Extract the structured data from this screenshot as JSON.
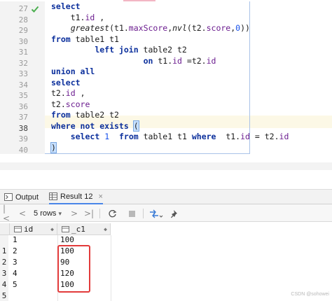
{
  "editor": {
    "line_numbers": [
      "27",
      "28",
      "29",
      "30",
      "31",
      "32",
      "33",
      "34",
      "35",
      "36",
      "37",
      "38",
      "39",
      "40"
    ],
    "active_line": "38",
    "lines": [
      [
        {
          "t": "select",
          "c": "kw"
        }
      ],
      [
        {
          "t": "    t1.",
          "c": ""
        },
        {
          "t": "id",
          "c": "fld"
        },
        {
          "t": " ,",
          "c": ""
        }
      ],
      [
        {
          "t": "    ",
          "c": ""
        },
        {
          "t": "greatest",
          "c": "fn"
        },
        {
          "t": "(t1.",
          "c": ""
        },
        {
          "t": "maxScore",
          "c": "fld"
        },
        {
          "t": ",",
          "c": ""
        },
        {
          "t": "nvl",
          "c": "fn"
        },
        {
          "t": "(t2.",
          "c": ""
        },
        {
          "t": "score",
          "c": "fld"
        },
        {
          "t": ",",
          "c": ""
        },
        {
          "t": "0",
          "c": "num"
        },
        {
          "t": "))",
          "c": ""
        }
      ],
      [
        {
          "t": "from",
          "c": "kw"
        },
        {
          "t": " table1 t1",
          "c": ""
        }
      ],
      [
        {
          "t": "         ",
          "c": ""
        },
        {
          "t": "left join",
          "c": "kw"
        },
        {
          "t": " table2 t2",
          "c": ""
        }
      ],
      [
        {
          "t": "                   ",
          "c": ""
        },
        {
          "t": "on",
          "c": "kw"
        },
        {
          "t": " t1.",
          "c": ""
        },
        {
          "t": "id",
          "c": "fld"
        },
        {
          "t": " =t2.",
          "c": ""
        },
        {
          "t": "id",
          "c": "fld"
        }
      ],
      [
        {
          "t": "union all",
          "c": "kw"
        }
      ],
      [
        {
          "t": "select",
          "c": "kw"
        }
      ],
      [
        {
          "t": "t2.",
          "c": ""
        },
        {
          "t": "id",
          "c": "fld"
        },
        {
          "t": " ,",
          "c": ""
        }
      ],
      [
        {
          "t": "t2.",
          "c": ""
        },
        {
          "t": "score",
          "c": "fld"
        }
      ],
      [
        {
          "t": "from",
          "c": "kw"
        },
        {
          "t": " table2 t2",
          "c": ""
        }
      ],
      [
        {
          "t": "where not exists",
          "c": "kw"
        },
        {
          "t": " ",
          "c": ""
        },
        {
          "t": "(",
          "c": "brace-hl"
        }
      ],
      [
        {
          "t": "    ",
          "c": ""
        },
        {
          "t": "select",
          "c": "kw"
        },
        {
          "t": " ",
          "c": ""
        },
        {
          "t": "1",
          "c": "num"
        },
        {
          "t": "  ",
          "c": ""
        },
        {
          "t": "from",
          "c": "kw"
        },
        {
          "t": " table1 t1 ",
          "c": ""
        },
        {
          "t": "where",
          "c": "kw"
        },
        {
          "t": "  t1.",
          "c": ""
        },
        {
          "t": "id",
          "c": "fld"
        },
        {
          "t": " = t2.",
          "c": ""
        },
        {
          "t": "id",
          "c": "fld"
        }
      ],
      [
        {
          "t": ")",
          "c": "brace-hl"
        }
      ]
    ]
  },
  "tabs": {
    "output_label": "Output",
    "result_label": "Result 12",
    "close_glyph": "×"
  },
  "toolbar": {
    "first_glyph": "|<",
    "prev_glyph": "<",
    "rows_label": "5 rows",
    "rows_caret": "▾",
    "next_glyph": ">",
    "last_glyph": ">|"
  },
  "grid": {
    "columns": [
      "id",
      "_c1"
    ],
    "rows": [
      {
        "num": "",
        "id": "1",
        "c1": "100"
      },
      {
        "num": "1",
        "id": "2",
        "c1": "100"
      },
      {
        "num": "2",
        "id": "3",
        "c1": "90"
      },
      {
        "num": "3",
        "id": "4",
        "c1": "120"
      },
      {
        "num": "4",
        "id": "5",
        "c1": "100"
      },
      {
        "num": "5",
        "id": "",
        "c1": ""
      }
    ]
  },
  "watermark": "CSDN @sohowei",
  "colors": {
    "keyword": "#0b2f9c",
    "field": "#6b1c8f",
    "number": "#1750eb",
    "highlight_box": "#e23b3b",
    "active_tab": "#4a86e8"
  }
}
